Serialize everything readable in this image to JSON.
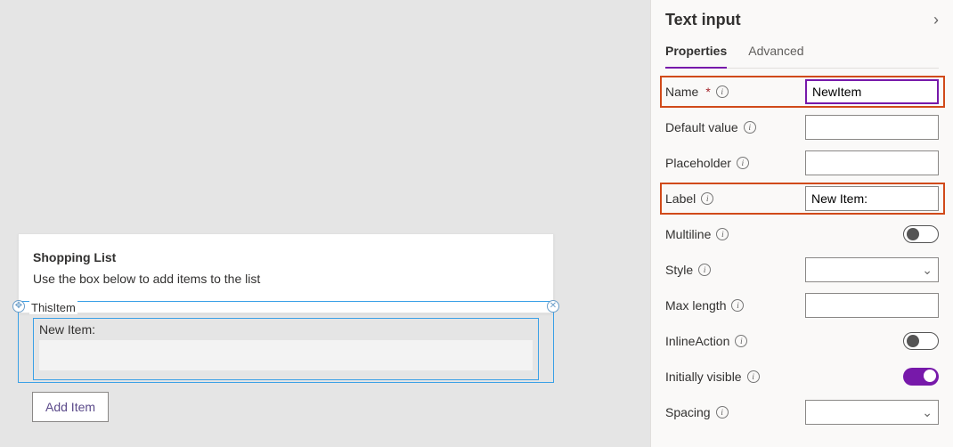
{
  "canvas": {
    "cardTitle": "Shopping List",
    "cardSubtitle": "Use the box below to add items to the list",
    "selectedControlName": "ThisItem",
    "fieldLabel": "New Item:",
    "addButton": "Add Item"
  },
  "panel": {
    "title": "Text input",
    "tabs": {
      "properties": "Properties",
      "advanced": "Advanced"
    },
    "rows": {
      "name": {
        "label": "Name",
        "required": true,
        "value": "NewItem"
      },
      "defaultValue": {
        "label": "Default value",
        "value": ""
      },
      "placeholder": {
        "label": "Placeholder",
        "value": ""
      },
      "labelProp": {
        "label": "Label",
        "value": "New Item:"
      },
      "multiline": {
        "label": "Multiline",
        "on": false
      },
      "style": {
        "label": "Style",
        "value": ""
      },
      "maxLength": {
        "label": "Max length",
        "value": ""
      },
      "inlineAction": {
        "label": "InlineAction",
        "on": false
      },
      "initiallyVisible": {
        "label": "Initially visible",
        "on": true
      },
      "spacing": {
        "label": "Spacing",
        "value": ""
      }
    }
  }
}
